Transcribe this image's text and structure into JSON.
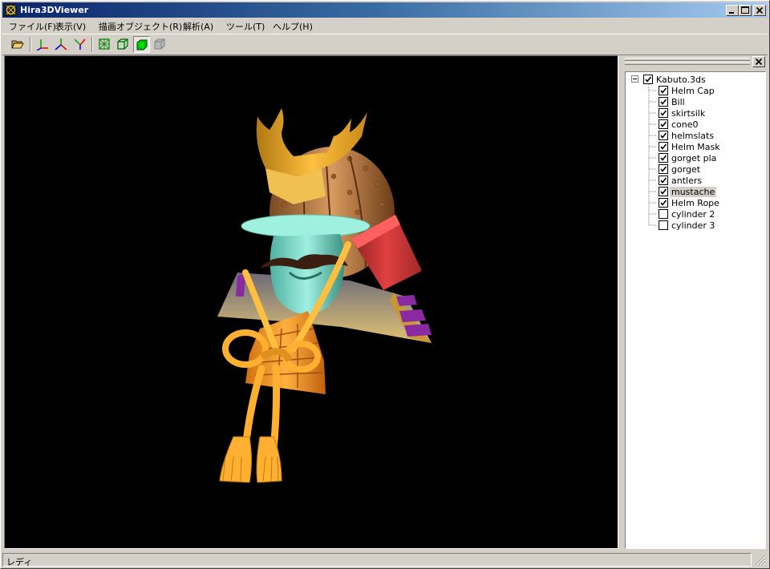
{
  "window": {
    "title": "Hira3DViewer",
    "title_bar_color": "#0a246a",
    "controls": [
      "minimize-icon",
      "maximize-icon",
      "close-icon"
    ]
  },
  "menu": [
    {
      "label": "ファイル(F)"
    },
    {
      "label": "表示(V)"
    },
    {
      "label": "描画オブジェクト(R)"
    },
    {
      "label": "解析(A)"
    },
    {
      "label": "ツール(T)"
    },
    {
      "label": "ヘルプ(H)"
    }
  ],
  "toolbar": {
    "buttons": [
      {
        "icon": "open-folder-icon"
      },
      {
        "icon": "axis-xy-icon"
      },
      {
        "icon": "axis-xz-icon"
      },
      {
        "icon": "axis-zy-icon"
      },
      {
        "icon": "wireframe-icon"
      },
      {
        "icon": "hidden-line-icon"
      },
      {
        "icon": "solid-shading-icon",
        "pressed": true
      },
      {
        "icon": "texture-shading-icon",
        "disabled": true
      }
    ]
  },
  "viewport": {
    "background": "#000000",
    "model": "Kabuto.3ds"
  },
  "tree": {
    "root": {
      "label": "Kabuto.3ds",
      "checked": true,
      "expanded": true
    },
    "items": [
      {
        "label": "Helm Cap",
        "checked": true
      },
      {
        "label": "Bill",
        "checked": true
      },
      {
        "label": "skirtsilk",
        "checked": true
      },
      {
        "label": "cone0",
        "checked": true
      },
      {
        "label": "helmslats",
        "checked": true
      },
      {
        "label": "Helm Mask",
        "checked": true
      },
      {
        "label": "gorget pla",
        "checked": true
      },
      {
        "label": "gorget",
        "checked": true
      },
      {
        "label": "antlers",
        "checked": true
      },
      {
        "label": "mustache",
        "checked": true,
        "selected": true
      },
      {
        "label": "Helm Rope",
        "checked": true
      },
      {
        "label": "cylinder 2",
        "checked": false
      },
      {
        "label": "cylinder 3",
        "checked": false
      }
    ]
  },
  "status": {
    "text": "レディ"
  }
}
